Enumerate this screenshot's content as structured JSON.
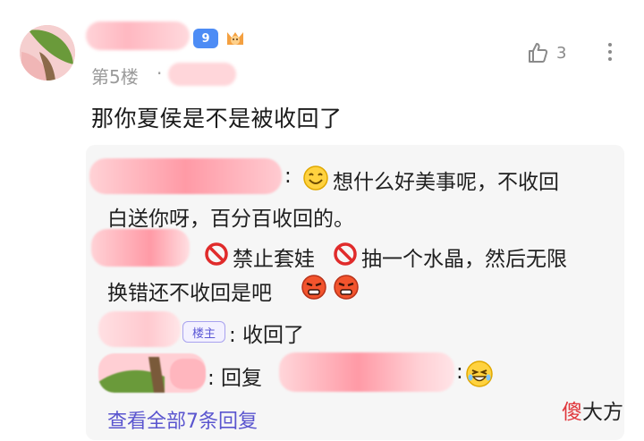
{
  "post": {
    "level": "9",
    "floor": "第5楼",
    "dot": "·",
    "like_count": "3",
    "content": "那你夏侯是不是被收回了"
  },
  "replies": {
    "r1_line1": "想什么好美事呢，不收回",
    "r1_line1_prefix": ":",
    "r1_line2": "白送你呀，百分百收回的。",
    "r2_a": "禁止套娃",
    "r2_b": "抽一个水晶，然后无限",
    "r2_line2": "换错还不收回是吧",
    "r3_badge": "楼主",
    "r3_text": ":  收回了",
    "r4_text": ":  回复",
    "r4_colon": ":",
    "view_all": "查看全部7条回复"
  },
  "watermark": {
    "first": "傻",
    "rest": "大方"
  },
  "colors": {
    "link": "#5a55cf",
    "badge_blue": "#4d8cf5",
    "blur_pink": "#ffb8c1",
    "reply_bg": "#f6f6f6"
  }
}
